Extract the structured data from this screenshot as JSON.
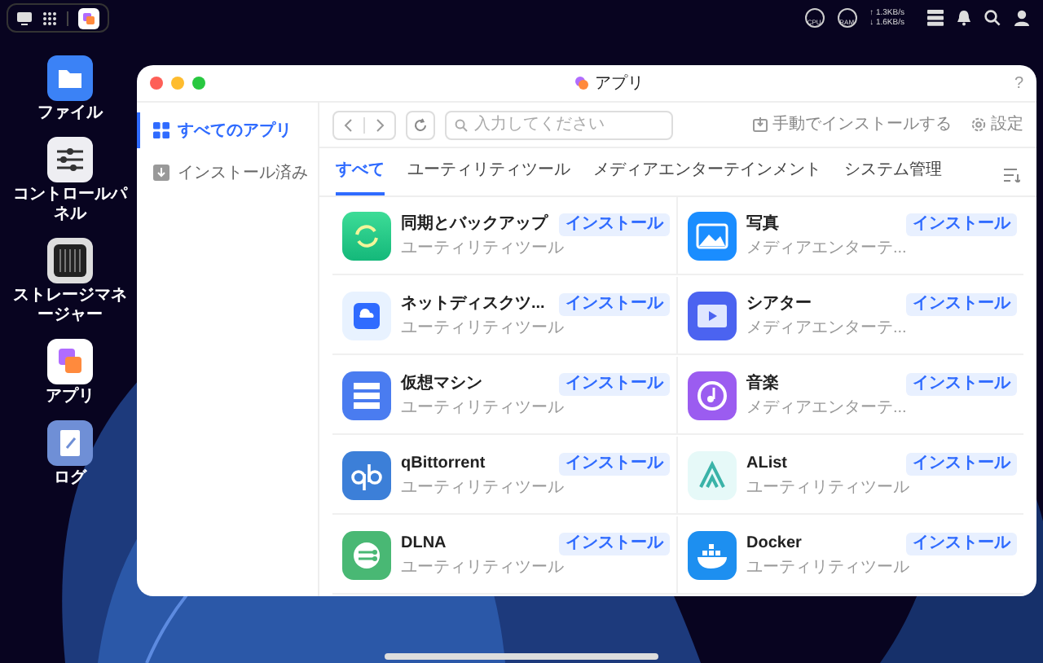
{
  "top_bar": {
    "gauges": [
      "CPU",
      "RAM"
    ],
    "upload": "↑ 1.3KB/s",
    "download": "↓ 1.6KB/s"
  },
  "desktop": {
    "icons": [
      {
        "kind": "files",
        "label": "ファイル"
      },
      {
        "kind": "control",
        "label": "コントロールパネル"
      },
      {
        "kind": "storage",
        "label": "ストレージマネージャー"
      },
      {
        "kind": "apps",
        "label": "アプリ"
      },
      {
        "kind": "log",
        "label": "ログ"
      }
    ]
  },
  "window": {
    "title": "アプリ",
    "help": "?"
  },
  "sidebar": {
    "items": [
      {
        "kind": "all",
        "label": "すべてのアプリ",
        "selected": true
      },
      {
        "kind": "installed",
        "label": "インストール済み",
        "selected": false
      }
    ]
  },
  "toolbar": {
    "search": {
      "placeholder": "入力してください"
    },
    "manual_install": "手動でインストールする",
    "settings": "設定"
  },
  "tabs": [
    {
      "label": "すべて",
      "selected": true
    },
    {
      "label": "ユーティリティツール",
      "selected": false
    },
    {
      "label": "メディアエンターテインメント",
      "selected": false
    },
    {
      "label": "システム管理",
      "selected": false
    }
  ],
  "apps": [
    {
      "kind": "sync",
      "name": "同期とバックアップ",
      "category": "ユーティリティツール",
      "button": "インストール"
    },
    {
      "kind": "photos",
      "name": "写真",
      "category": "メディアエンターテ...",
      "button": "インストール"
    },
    {
      "kind": "netdisk",
      "name": "ネットディスクツ...",
      "category": "ユーティリティツール",
      "button": "インストール"
    },
    {
      "kind": "theater",
      "name": "シアター",
      "category": "メディアエンターテ...",
      "button": "インストール"
    },
    {
      "kind": "vm",
      "name": "仮想マシン",
      "category": "ユーティリティツール",
      "button": "インストール"
    },
    {
      "kind": "music",
      "name": "音楽",
      "category": "メディアエンターテ...",
      "button": "インストール"
    },
    {
      "kind": "qbit",
      "name": "qBittorrent",
      "category": "ユーティリティツール",
      "button": "インストール"
    },
    {
      "kind": "alist",
      "name": "AList",
      "category": "ユーティリティツール",
      "button": "インストール"
    },
    {
      "kind": "dlna",
      "name": "DLNA",
      "category": "ユーティリティツール",
      "button": "インストール"
    },
    {
      "kind": "docker",
      "name": "Docker",
      "category": "ユーティリティツール",
      "button": "インストール"
    }
  ]
}
